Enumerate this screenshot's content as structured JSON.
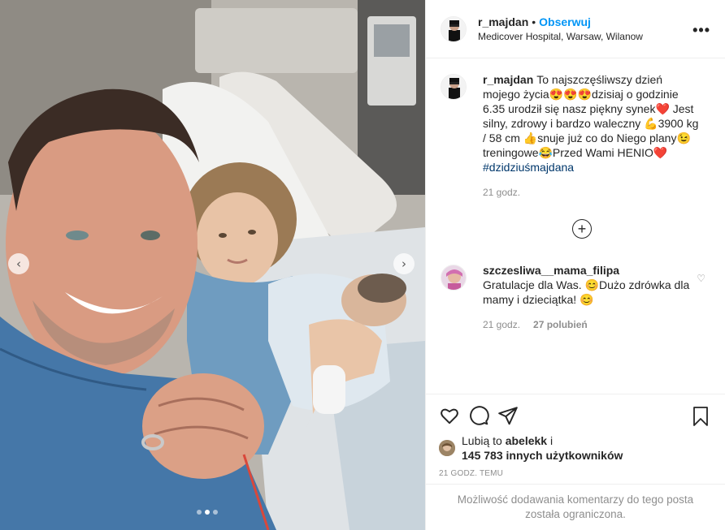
{
  "post": {
    "username": "r_majdan",
    "follow_label": "Obserwuj",
    "separator": "•",
    "location": "Medicover Hospital, Warsaw, Wilanow",
    "more_icon": "more-dots-icon",
    "more_glyph": "•••"
  },
  "caption": {
    "username": "r_majdan",
    "text": "To najszczęśliwszy dzień mojego życia😍😍😍dzisiaj o godzinie 6.35 urodził się nasz piękny synek❤️ Jest silny, zdrowy i bardzo waleczny 💪3900 kg / 58 cm 👍snuje już co do Niego plany😉treningowe😂Przed Wami HENIO❤️",
    "hashtag": "#dzidziuśmajdana",
    "time": "21 godz."
  },
  "load_more": {
    "glyph": "+",
    "icon": "plus-circle-icon"
  },
  "comments": [
    {
      "username": "szczesliwa__mama_filipa",
      "text": "Gratulacje dla Was. 😊Dużo zdrówka dla mamy i dzieciątka! 😊",
      "time": "21 godz.",
      "likes": "27 polubień",
      "heart_glyph": "♡"
    }
  ],
  "actions": {
    "like_icon": "heart-icon",
    "comment_icon": "comment-icon",
    "share_icon": "share-icon",
    "save_icon": "bookmark-icon"
  },
  "likes": {
    "prefix": "Lubią to ",
    "user": "abelekk",
    "suffix": " i",
    "count": "145 783 innych użytkowników"
  },
  "timestamp": "21 GODZ. TEMU",
  "restricted_notice": "Możliwość dodawania komentarzy do tego posta została ograniczona.",
  "carousel": {
    "left_glyph": "‹",
    "right_glyph": "›",
    "slide_count": 3,
    "active_index": 1
  },
  "colors": {
    "link": "#0095f6",
    "hashtag": "#00376b",
    "muted": "#8e8e8e",
    "text": "#262626"
  }
}
